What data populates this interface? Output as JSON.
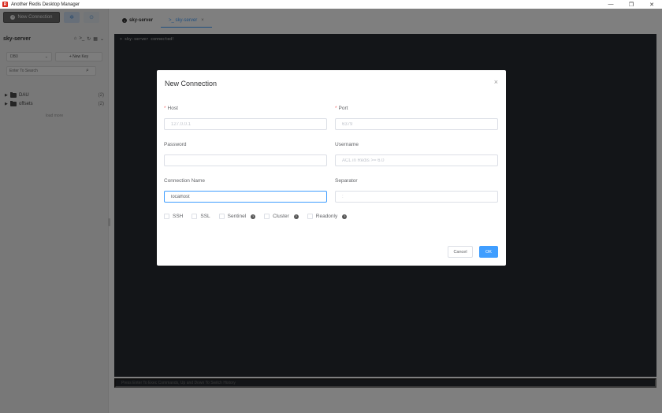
{
  "window": {
    "title": "Another Redis Desktop Manager",
    "minimize": "—",
    "maximize": "❐",
    "close": "✕"
  },
  "sidebar": {
    "new_connection_label": "New Connection",
    "server_name": "sky-server",
    "db_select": "DB0",
    "new_key_label": "+ New Key",
    "search_placeholder": "Enter To Search",
    "tree": [
      {
        "label": "DAU",
        "count": "(2)"
      },
      {
        "label": "offsets",
        "count": "(2)"
      }
    ],
    "load_more": "load more"
  },
  "tabs": [
    {
      "label": "sky-server"
    },
    {
      "label": ">_ sky-server"
    }
  ],
  "console": {
    "output": "> sky-server connected!",
    "input_placeholder": "Press Enter To Exec Commands, Up and Down To Switch History"
  },
  "dialog": {
    "title": "New Connection",
    "host_label": "Host",
    "host_placeholder": "127.0.0.1",
    "port_label": "Port",
    "port_placeholder": "6379",
    "password_label": "Password",
    "password_value": "",
    "username_label": "Username",
    "username_placeholder": "ACL in Redis >= 6.0",
    "conn_name_label": "Connection Name",
    "conn_name_value": "localhost",
    "separator_label": "Separator",
    "separator_placeholder": ":",
    "checkboxes": [
      {
        "label": "SSH"
      },
      {
        "label": "SSL"
      },
      {
        "label": "Sentinel"
      },
      {
        "label": "Cluster"
      },
      {
        "label": "Readonly"
      }
    ],
    "cancel_label": "Cancel",
    "ok_label": "OK"
  },
  "colors": {
    "accent": "#409eff",
    "required": "#f56c6c",
    "console_bg": "#262b30"
  }
}
